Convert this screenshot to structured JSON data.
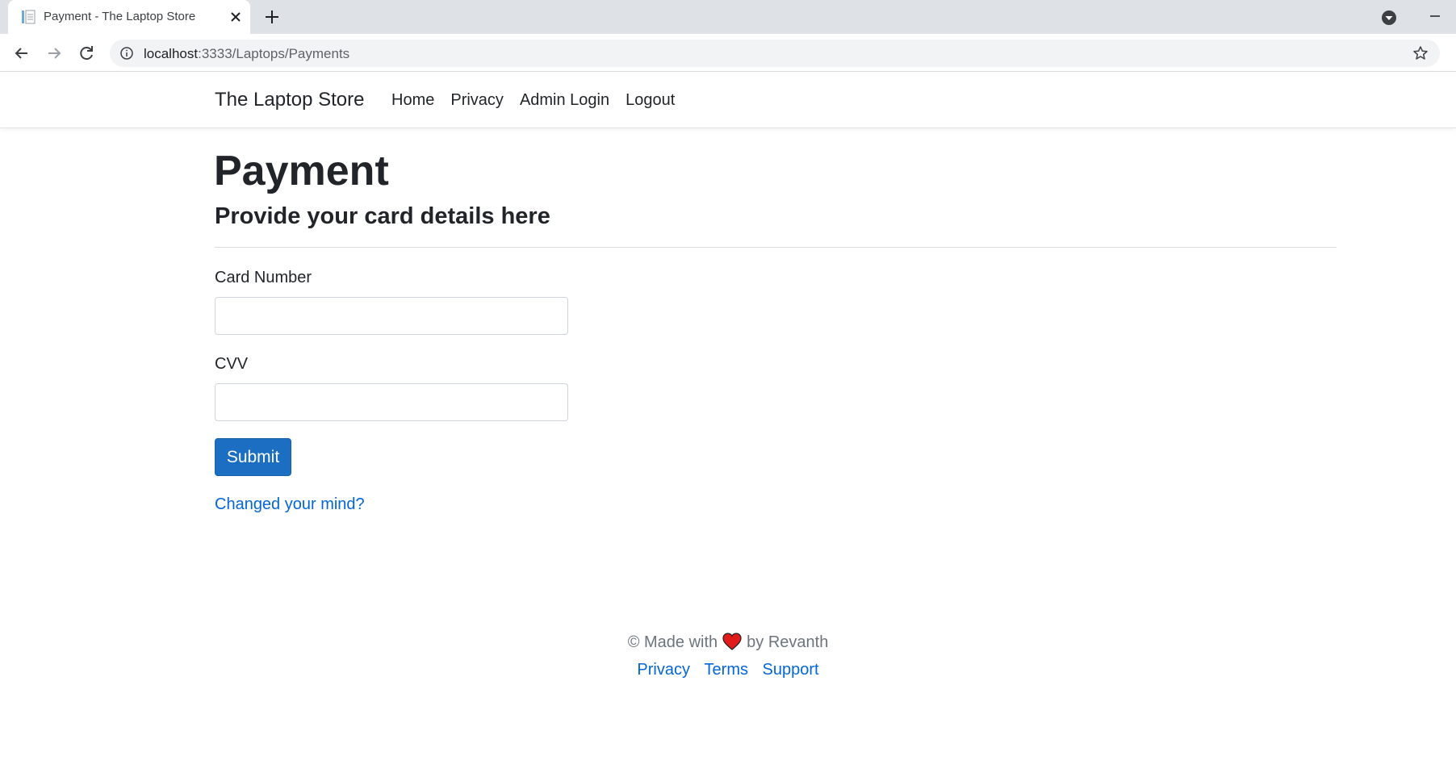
{
  "browser": {
    "tab_title": "Payment - The Laptop Store",
    "url_host": "localhost",
    "url_rest": ":3333/Laptops/Payments"
  },
  "navbar": {
    "brand": "The Laptop Store",
    "links": [
      "Home",
      "Privacy",
      "Admin Login",
      "Logout"
    ]
  },
  "main": {
    "title": "Payment",
    "subtitle": "Provide your card details here",
    "card_number_label": "Card Number",
    "card_number_value": "",
    "cvv_label": "CVV",
    "cvv_value": "",
    "submit_label": "Submit",
    "changed_mind_link": "Changed your mind?"
  },
  "footer": {
    "prefix": "© Made with",
    "suffix": "by Revanth",
    "links": [
      "Privacy",
      "Terms",
      "Support"
    ]
  },
  "colors": {
    "primary_button": "#1b6ec2",
    "link": "#0366d6",
    "heart": "#e21b1b"
  },
  "icons": [
    "document-icon",
    "close-icon",
    "plus-icon",
    "profile-dropdown-icon",
    "minimize-icon",
    "back-arrow-icon",
    "forward-arrow-icon",
    "reload-icon",
    "info-icon",
    "star-icon",
    "heart-icon"
  ]
}
